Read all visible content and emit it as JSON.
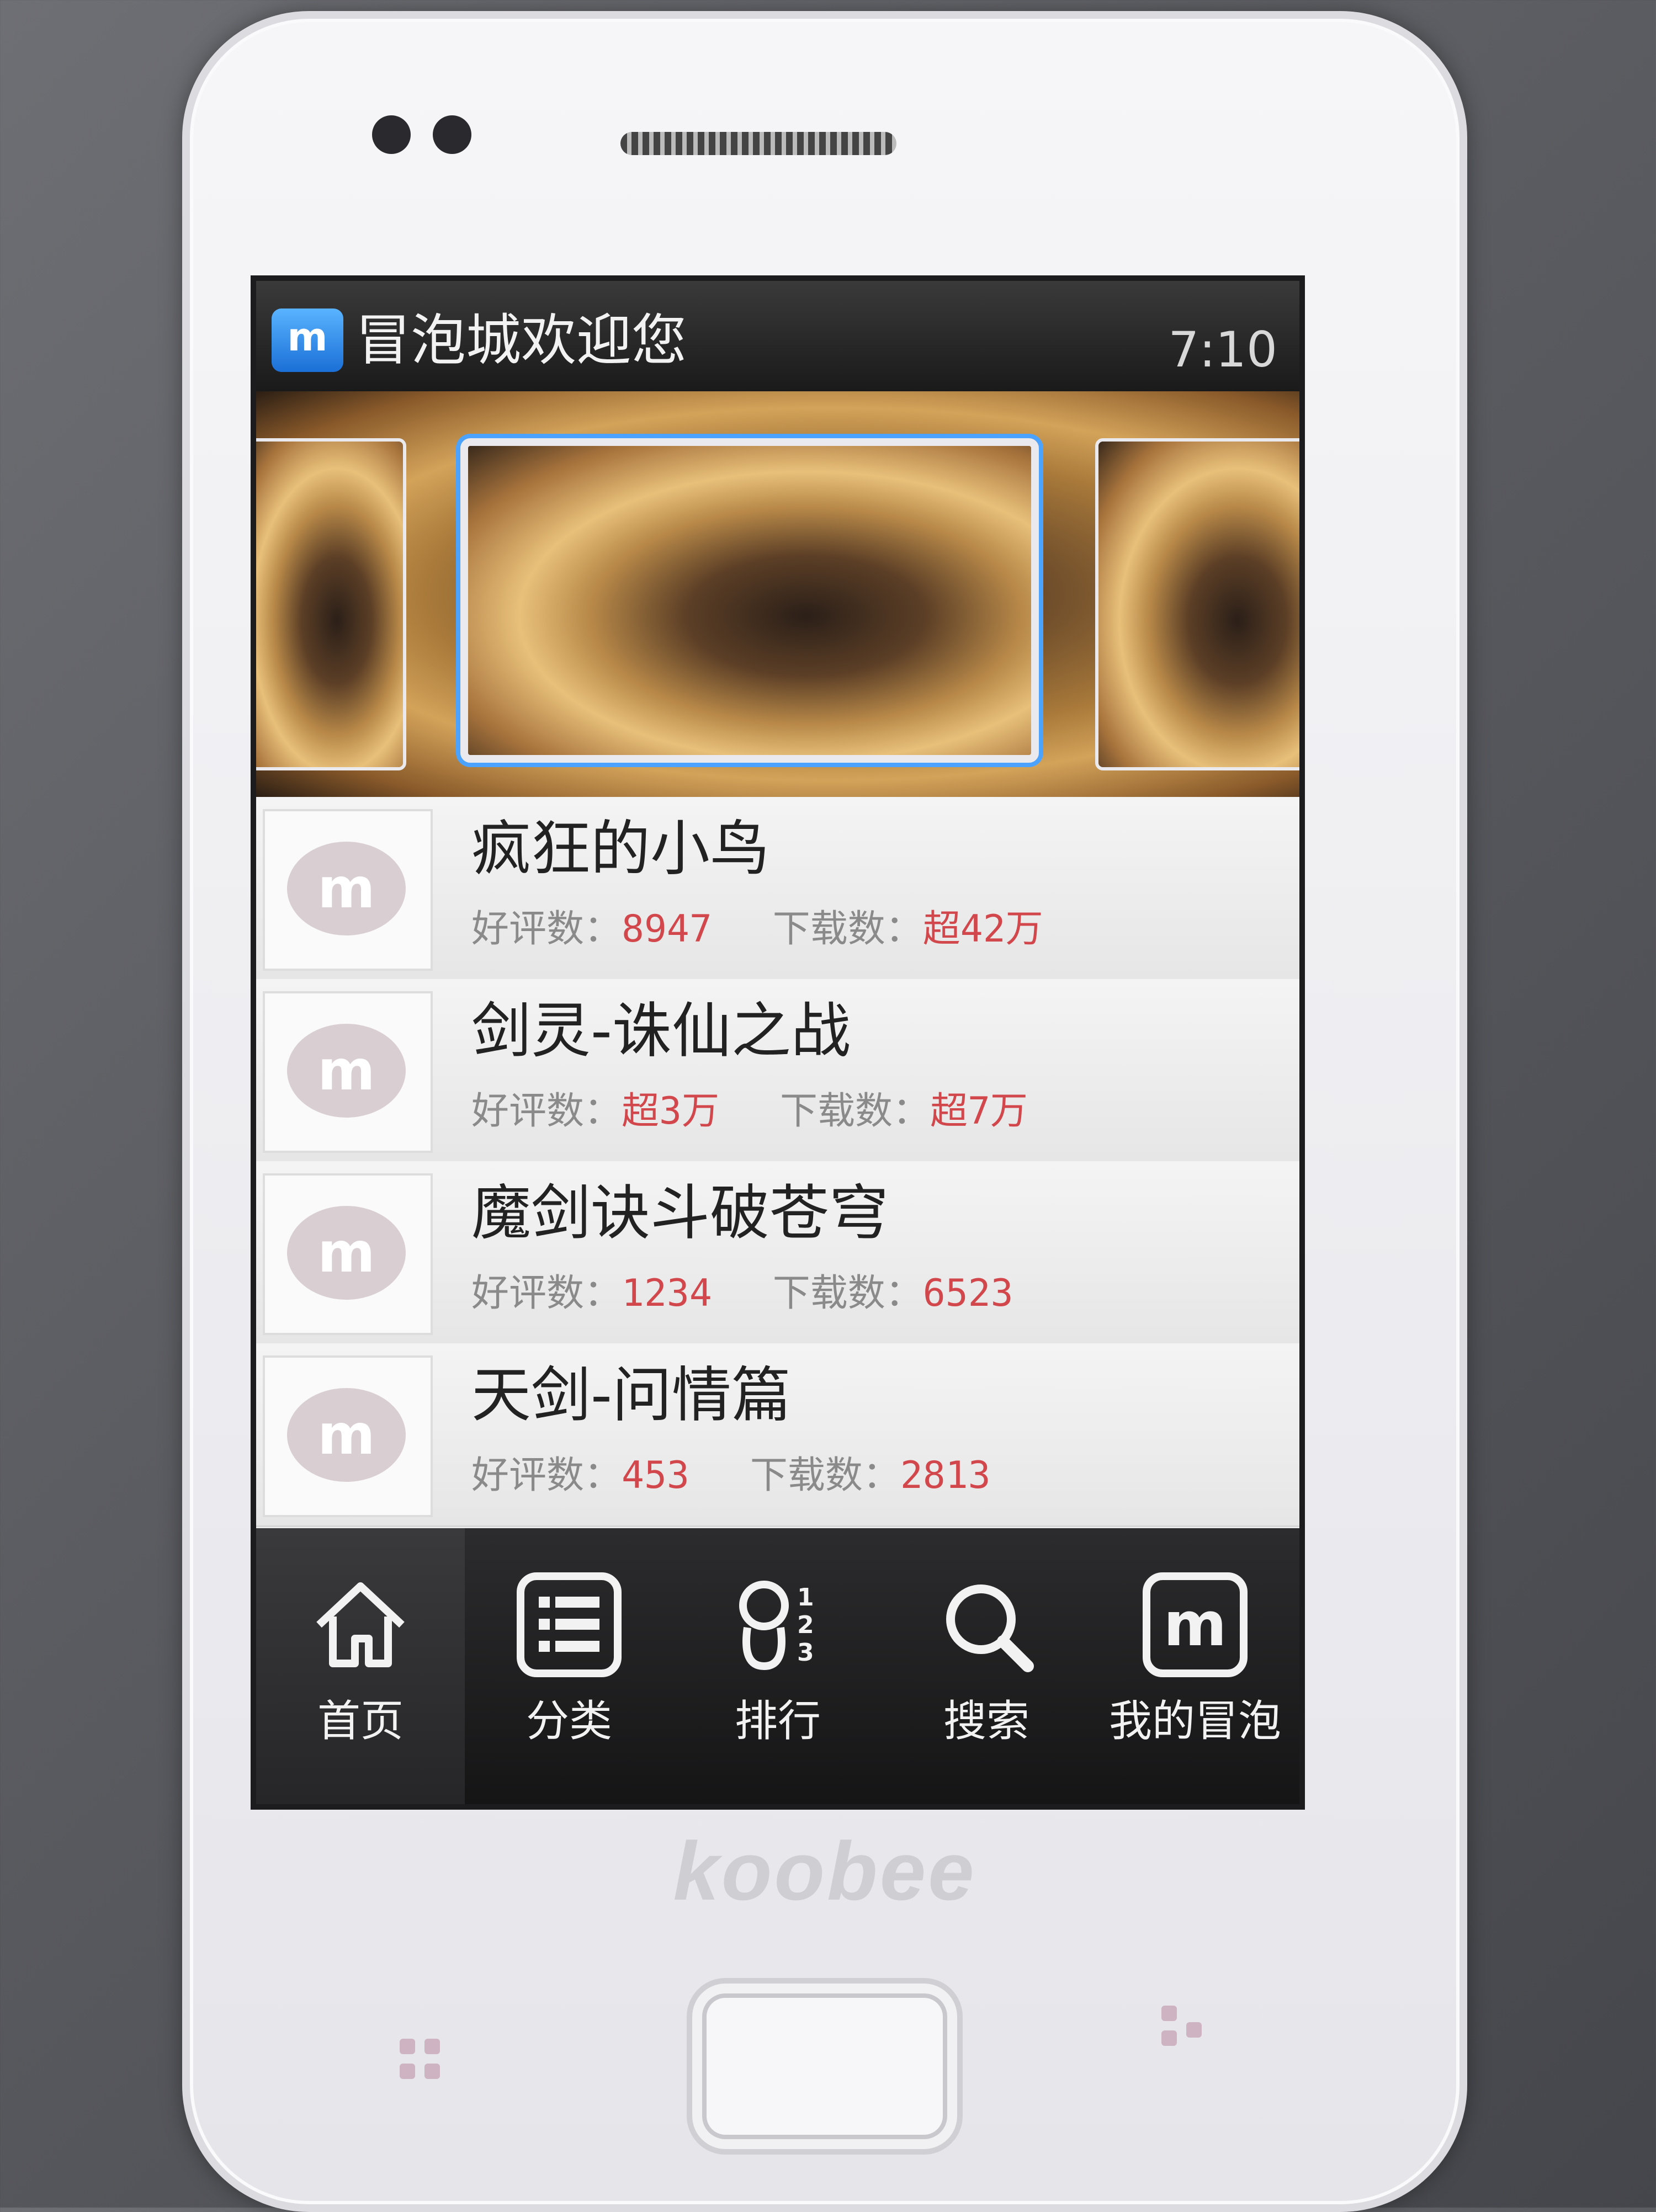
{
  "statusbar": {
    "title": "冒泡城欢迎您",
    "time": "7:10",
    "app_icon_glyph": "m"
  },
  "apps": [
    {
      "name": "疯狂的小鸟",
      "rating_label": "好评数：",
      "rating": "8947",
      "downloads_label": "下载数：",
      "downloads": "超42万"
    },
    {
      "name": "剑灵-诛仙之战",
      "rating_label": "好评数：",
      "rating": "超3万",
      "downloads_label": "下载数：",
      "downloads": "超7万"
    },
    {
      "name": "魔剑诀斗破苍穹",
      "rating_label": "好评数：",
      "rating": "1234",
      "downloads_label": "下载数：",
      "downloads": "6523"
    },
    {
      "name": "天剑-问情篇",
      "rating_label": "好评数：",
      "rating": "453",
      "downloads_label": "下载数：",
      "downloads": "2813"
    }
  ],
  "tabs": [
    {
      "label": "首页",
      "icon": "home-icon"
    },
    {
      "label": "分类",
      "icon": "list-icon"
    },
    {
      "label": "排行",
      "icon": "ranking-icon"
    },
    {
      "label": "搜索",
      "icon": "search-icon"
    },
    {
      "label": "我的冒泡",
      "icon": "m-logo-icon"
    }
  ],
  "device": {
    "brand": "koobee"
  },
  "colors": {
    "accent": "#4ba3ff",
    "value_red": "#d2474b"
  }
}
